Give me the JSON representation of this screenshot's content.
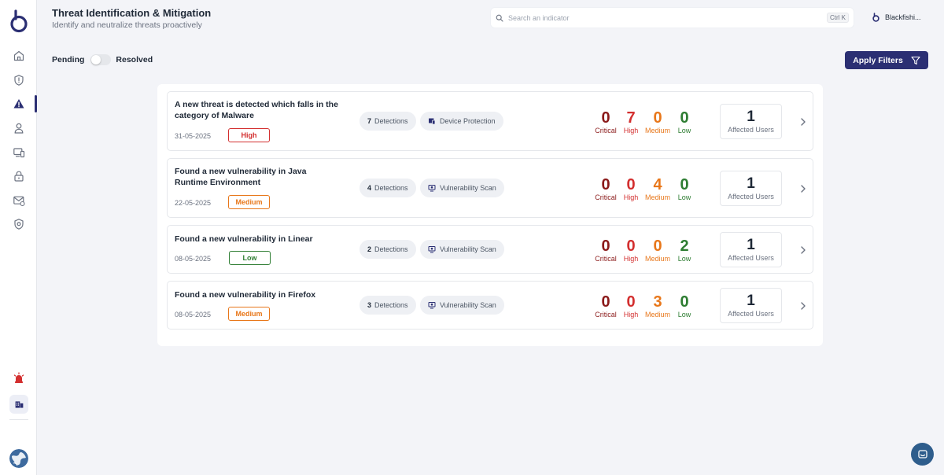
{
  "header": {
    "title": "Threat Identification & Mitigation",
    "subtitle": "Identify and neutralize threats proactively"
  },
  "search": {
    "placeholder": "Search an indicator",
    "shortcut": "Ctrl K"
  },
  "org": {
    "name": "Blackfishi..."
  },
  "filters": {
    "pending_label": "Pending",
    "resolved_label": "Resolved",
    "toggle_resolved": false,
    "apply_label": "Apply Filters"
  },
  "labels": {
    "detections": "Detections",
    "critical": "Critical",
    "high": "High",
    "medium": "Medium",
    "low": "Low",
    "affected_users": "Affected Users"
  },
  "threats": [
    {
      "title": "A new threat is detected which falls in the category of Malware",
      "date": "31-05-2025",
      "severity": "High",
      "detections": "7",
      "source": "Device Protection",
      "source_icon": "device-protection-icon",
      "critical": "0",
      "high": "7",
      "medium": "0",
      "low": "0",
      "affected": "1"
    },
    {
      "title": "Found a new vulnerability in Java Runtime Environment",
      "date": "22-05-2025",
      "severity": "Medium",
      "detections": "4",
      "source": "Vulnerability Scan",
      "source_icon": "vulnerability-scan-icon",
      "critical": "0",
      "high": "0",
      "medium": "4",
      "low": "0",
      "affected": "1"
    },
    {
      "title": "Found a new vulnerability in Linear",
      "date": "08-05-2025",
      "severity": "Low",
      "detections": "2",
      "source": "Vulnerability Scan",
      "source_icon": "vulnerability-scan-icon",
      "critical": "0",
      "high": "0",
      "medium": "0",
      "low": "2",
      "affected": "1"
    },
    {
      "title": "Found a new vulnerability in Firefox",
      "date": "08-05-2025",
      "severity": "Medium",
      "detections": "3",
      "source": "Vulnerability Scan",
      "source_icon": "vulnerability-scan-icon",
      "critical": "0",
      "high": "0",
      "medium": "3",
      "low": "0",
      "affected": "1"
    }
  ],
  "sidebar": {
    "items": [
      {
        "icon": "home-icon"
      },
      {
        "icon": "shield-icon"
      },
      {
        "icon": "threat-warning-icon",
        "active": true
      },
      {
        "icon": "users-icon"
      },
      {
        "icon": "devices-icon"
      },
      {
        "icon": "lock-icon"
      },
      {
        "icon": "email-security-icon"
      },
      {
        "icon": "privacy-shield-icon"
      }
    ],
    "alarm_icon": "alarm-icon",
    "org_icon": "organization-icon",
    "avatar_icon": "globe-avatar-icon"
  },
  "colors": {
    "primary": "#2b2f73",
    "critical": "#8b1a1a",
    "high": "#d32f2f",
    "medium": "#e8771a",
    "low": "#2e7d32",
    "chat": "#2e5d8c"
  }
}
